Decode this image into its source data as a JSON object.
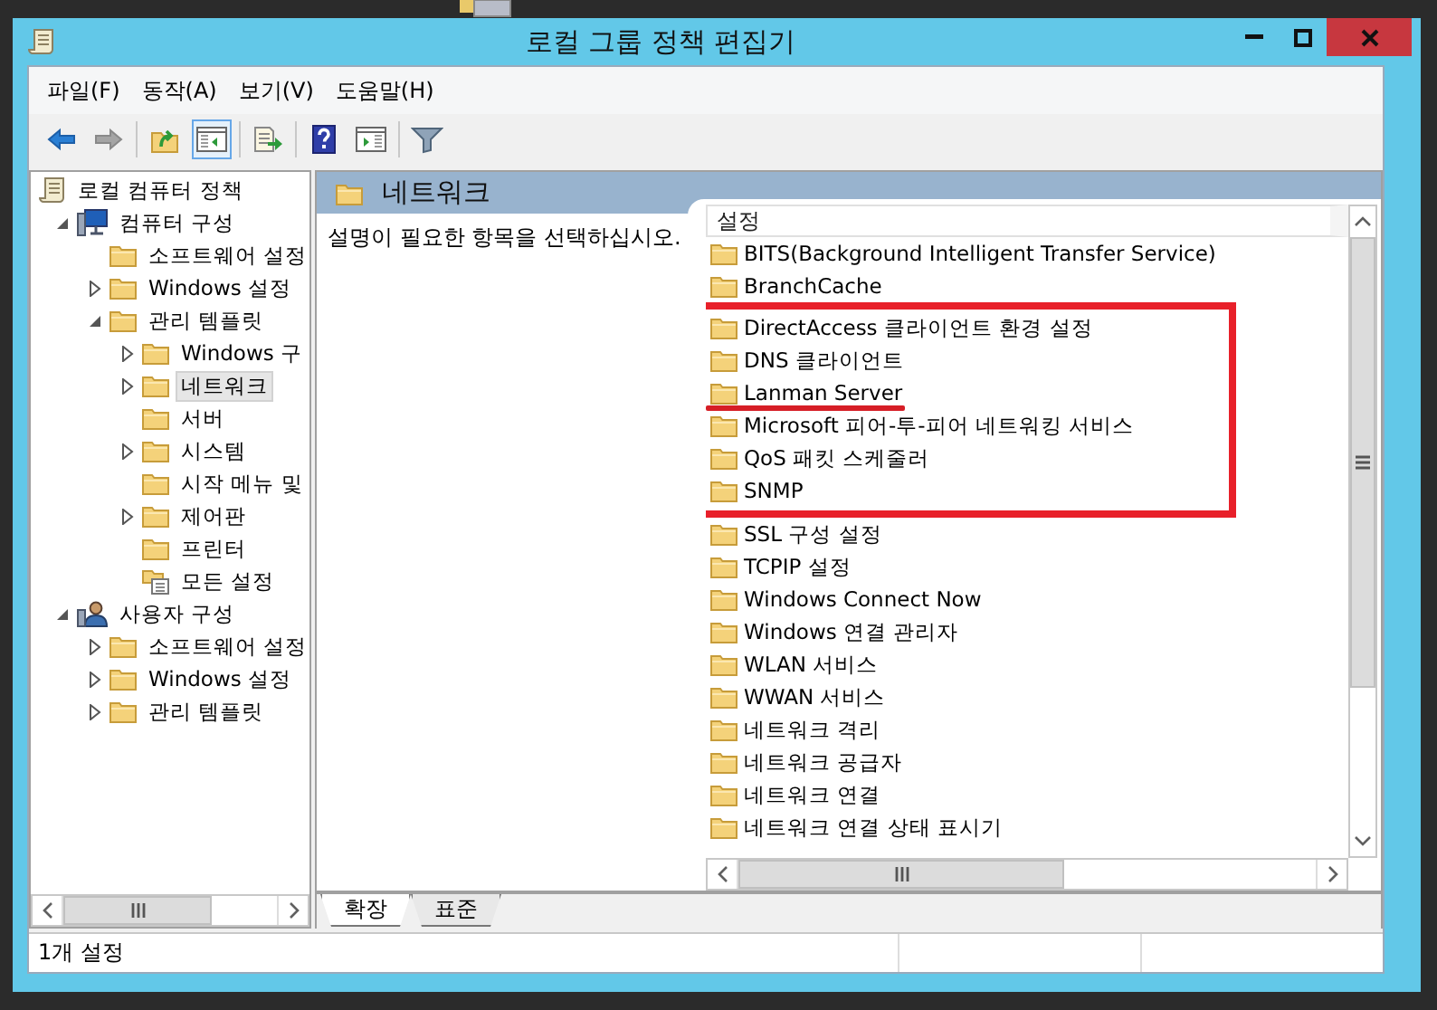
{
  "window": {
    "title": "로컬 그룹 정책 편집기"
  },
  "menu": [
    "파일(F)",
    "동작(A)",
    "보기(V)",
    "도움말(H)"
  ],
  "toolbar": [
    {
      "buttons": [
        {
          "kind": "back",
          "disabled": false,
          "pressed": false
        },
        {
          "kind": "forward",
          "disabled": true,
          "pressed": false
        }
      ]
    },
    {
      "buttons": [
        {
          "kind": "up",
          "disabled": false,
          "pressed": false
        },
        {
          "kind": "tree-toggle",
          "disabled": false,
          "pressed": true
        }
      ]
    },
    {
      "buttons": [
        {
          "kind": "export",
          "disabled": false,
          "pressed": false
        }
      ]
    },
    {
      "buttons": [
        {
          "kind": "help",
          "disabled": false,
          "pressed": false
        },
        {
          "kind": "action-pane",
          "disabled": false,
          "pressed": false
        }
      ]
    },
    {
      "buttons": [
        {
          "kind": "filter",
          "disabled": false,
          "pressed": false
        }
      ]
    }
  ],
  "tree": {
    "label": "로컬 컴퓨터 정책",
    "kind": "policy",
    "selected": false,
    "children": [
      {
        "label": "컴퓨터 구성",
        "kind": "computer",
        "expanded": true,
        "selected": false,
        "children": [
          {
            "label": "소프트웨어 설정",
            "kind": "folder",
            "selected": false
          },
          {
            "label": "Windows 설정",
            "kind": "folder",
            "expanded": false,
            "selected": false
          },
          {
            "label": "관리 템플릿",
            "kind": "folder",
            "expanded": true,
            "selected": false,
            "children": [
              {
                "label": "Windows 구",
                "kind": "folder",
                "expanded": false,
                "selected": false
              },
              {
                "label": "네트워크",
                "kind": "folder",
                "expanded": false,
                "selected": true
              },
              {
                "label": "서버",
                "kind": "folder",
                "selected": false
              },
              {
                "label": "시스템",
                "kind": "folder",
                "expanded": false,
                "selected": false
              },
              {
                "label": "시작 메뉴 및",
                "kind": "folder",
                "selected": false
              },
              {
                "label": "제어판",
                "kind": "folder",
                "expanded": false,
                "selected": false
              },
              {
                "label": "프린터",
                "kind": "folder",
                "selected": false
              },
              {
                "label": "모든 설정",
                "kind": "settings",
                "selected": false
              }
            ]
          }
        ]
      },
      {
        "label": "사용자 구성",
        "kind": "user",
        "expanded": true,
        "selected": false,
        "children": [
          {
            "label": "소프트웨어 설정",
            "kind": "folder",
            "expanded": false,
            "selected": false
          },
          {
            "label": "Windows 설정",
            "kind": "folder",
            "expanded": false,
            "selected": false
          },
          {
            "label": "관리 템플릿",
            "kind": "folder",
            "expanded": false,
            "selected": false
          }
        ]
      }
    ]
  },
  "header": {
    "title": "네트워크"
  },
  "description": "설명이 필요한 항목을 선택하십시오.",
  "list": {
    "column": "설정",
    "groups": [
      {
        "boxed": false,
        "rows": [
          {
            "label": "BITS(Background Intelligent Transfer Service)",
            "underlined": false
          },
          {
            "label": "BranchCache",
            "underlined": false
          }
        ]
      },
      {
        "boxed": true,
        "rows": [
          {
            "label": "DirectAccess 클라이언트 환경 설정",
            "underlined": false
          },
          {
            "label": "DNS 클라이언트",
            "underlined": false
          },
          {
            "label": "Lanman Server",
            "underlined": true
          },
          {
            "label": "Microsoft 피어-투-피어 네트워킹 서비스",
            "underlined": false
          },
          {
            "label": "QoS 패킷 스케줄러",
            "underlined": false
          },
          {
            "label": "SNMP",
            "underlined": false
          }
        ]
      },
      {
        "boxed": false,
        "rows": [
          {
            "label": "SSL 구성 설정",
            "underlined": false
          },
          {
            "label": "TCPIP 설정",
            "underlined": false
          },
          {
            "label": "Windows Connect Now",
            "underlined": false
          },
          {
            "label": "Windows 연결 관리자",
            "underlined": false
          },
          {
            "label": "WLAN 서비스",
            "underlined": false
          },
          {
            "label": "WWAN 서비스",
            "underlined": false
          },
          {
            "label": "네트워크 격리",
            "underlined": false
          },
          {
            "label": "네트워크 공급자",
            "underlined": false
          },
          {
            "label": "네트워크 연결",
            "underlined": false
          },
          {
            "label": "네트워크 연결 상태 표시기",
            "underlined": false
          }
        ]
      }
    ]
  },
  "tabs": [
    {
      "label": "확장",
      "selected": true
    },
    {
      "label": "표준",
      "selected": false
    }
  ],
  "status_bar": {
    "text": "1개 설정"
  }
}
